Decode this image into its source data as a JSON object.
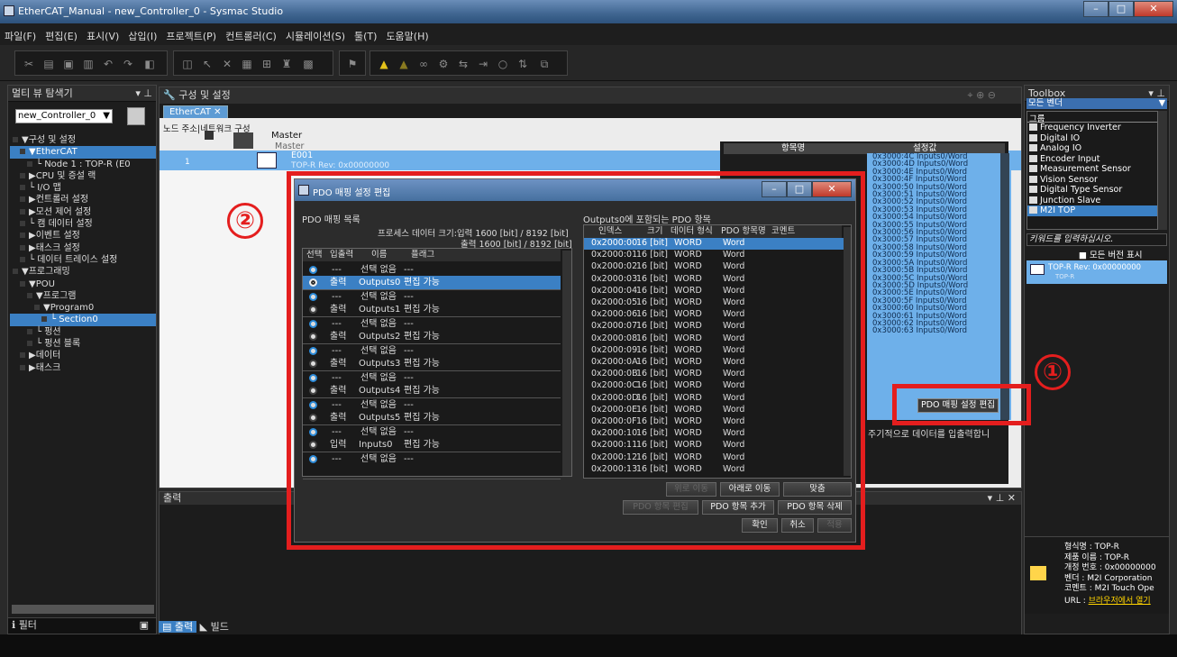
{
  "window": {
    "title": "EtherCAT_Manual - new_Controller_0 - Sysmac Studio"
  },
  "menu": [
    "파일(F)",
    "편집(E)",
    "표시(V)",
    "삽입(I)",
    "프로젝트(P)",
    "컨트롤러(C)",
    "시뮬레이션(S)",
    "툴(T)",
    "도움말(H)"
  ],
  "left": {
    "title": "멀티 뷰 탐색기",
    "controller": "new_Controller_0",
    "tree": [
      {
        "label": "▼구성 및 설정",
        "indent": 0,
        "sel": false
      },
      {
        "label": "▼EtherCAT",
        "indent": 1,
        "sel": true
      },
      {
        "label": "└ Node 1 : TOP-R (E0",
        "indent": 2,
        "sel": false
      },
      {
        "label": "▶CPU 및 증설 랙",
        "indent": 1,
        "sel": false
      },
      {
        "label": "└ I/O 맵",
        "indent": 1,
        "sel": false
      },
      {
        "label": "▶컨트롤러 설정",
        "indent": 1,
        "sel": false
      },
      {
        "label": "▶모션 제어 설정",
        "indent": 1,
        "sel": false
      },
      {
        "label": "└ 캠 데이터 설정",
        "indent": 1,
        "sel": false
      },
      {
        "label": "▶이벤트 설정",
        "indent": 1,
        "sel": false
      },
      {
        "label": "▶태스크 설정",
        "indent": 1,
        "sel": false
      },
      {
        "label": "└ 데이터 트레이스 설정",
        "indent": 1,
        "sel": false
      },
      {
        "label": "▼프로그래밍",
        "indent": 0,
        "sel": false
      },
      {
        "label": "▼POU",
        "indent": 1,
        "sel": false
      },
      {
        "label": "▼프로그램",
        "indent": 2,
        "sel": false
      },
      {
        "label": "▼Program0",
        "indent": 3,
        "sel": false
      },
      {
        "label": "└ Section0",
        "indent": 4,
        "sel": true
      },
      {
        "label": "└ 펑션",
        "indent": 2,
        "sel": false
      },
      {
        "label": "└ 펑션 블록",
        "indent": 2,
        "sel": false
      },
      {
        "label": "▶데이터",
        "indent": 1,
        "sel": false
      },
      {
        "label": "▶태스크",
        "indent": 1,
        "sel": false
      }
    ],
    "filter": "필터"
  },
  "center": {
    "title": "구성 및 설정",
    "tab": "EtherCAT",
    "col_node": "노드 주소",
    "col_net": "네트워크 구성",
    "master": "Master",
    "master2": "Master",
    "node_addr": "1",
    "node_name": "E001",
    "node_rev": "TOP-R Rev: 0x00000000",
    "settings_hdr1": "항목명",
    "settings_hdr2": "설정값",
    "settings_values": [
      "0x3000:4C Inputs0/Word",
      "0x3000:4D Inputs0/Word",
      "0x3000:4E Inputs0/Word",
      "0x3000:4F Inputs0/Word",
      "0x3000:50 Inputs0/Word",
      "0x3000:51 Inputs0/Word",
      "0x3000:52 Inputs0/Word",
      "0x3000:53 Inputs0/Word",
      "0x3000:54 Inputs0/Word",
      "0x3000:55 Inputs0/Word",
      "0x3000:56 Inputs0/Word",
      "0x3000:57 Inputs0/Word",
      "0x3000:58 Inputs0/Word",
      "0x3000:59 Inputs0/Word",
      "0x3000:5A Inputs0/Word",
      "0x3000:5B Inputs0/Word",
      "0x3000:5C Inputs0/Word",
      "0x3000:5D Inputs0/Word",
      "0x3000:5E Inputs0/Word",
      "0x3000:5F Inputs0/Word",
      "0x3000:60 Inputs0/Word",
      "0x3000:61 Inputs0/Word",
      "0x3000:62 Inputs0/Word",
      "0x3000:63 Inputs0/Word"
    ],
    "pdo_btn": "PDO 매핑 설정 편집",
    "desc": "주기적으로 데이터를 입출력합니"
  },
  "output": {
    "title": "출력",
    "tab_out": "출력",
    "tab_build": "빌드"
  },
  "toolbox": {
    "title": "Toolbox",
    "vendor": "모든 벤더",
    "group": "그룹",
    "items": [
      "Frequency Inverter",
      "Digital IO",
      "Analog IO",
      "Encoder Input",
      "Measurement Sensor",
      "Vision Sensor",
      "Digital Type Sensor",
      "Junction Slave",
      "M2I TOP"
    ],
    "keyword_placeholder": "키워드를 입력하십시오.",
    "allver": "모든 버전 표시",
    "device": "TOP-R Rev: 0x00000000",
    "device_sub": "TOP-R",
    "info": [
      "형식명 : TOP-R",
      "제품 이름 : TOP-R",
      "개정 번호 : 0x00000000",
      "벤더 : M2I Corporation",
      "코멘트 : M2I Touch Ope"
    ],
    "url_label": "URL : ",
    "url_link": "브라우저에서 열기"
  },
  "dialog": {
    "title": "PDO 매핑 설정 편집",
    "list_title": "PDO 매핑 목록",
    "size_in": "프로세스 데이터 크기:입력 1600 [bit] / 8192 [bit]",
    "size_out": "출력 1600 [bit] / 8192 [bit]",
    "cols": [
      "선택",
      "입출력",
      "이름",
      "플래그"
    ],
    "groups": [
      {
        "r1": [
          "---",
          "선택 없음",
          "---"
        ],
        "r2": [
          "출력",
          "Outputs0",
          "편집 가능"
        ],
        "sel": 2
      },
      {
        "r1": [
          "---",
          "선택 없음",
          "---"
        ],
        "r2": [
          "출력",
          "Outputs1",
          "편집 가능"
        ],
        "sel": 0
      },
      {
        "r1": [
          "---",
          "선택 없음",
          "---"
        ],
        "r2": [
          "출력",
          "Outputs2",
          "편집 가능"
        ],
        "sel": 0
      },
      {
        "r1": [
          "---",
          "선택 없음",
          "---"
        ],
        "r2": [
          "출력",
          "Outputs3",
          "편집 가능"
        ],
        "sel": 0
      },
      {
        "r1": [
          "---",
          "선택 없음",
          "---"
        ],
        "r2": [
          "출력",
          "Outputs4",
          "편집 가능"
        ],
        "sel": 0
      },
      {
        "r1": [
          "---",
          "선택 없음",
          "---"
        ],
        "r2": [
          "출력",
          "Outputs5",
          "편집 가능"
        ],
        "sel": 0
      },
      {
        "r1": [
          "---",
          "선택 없음",
          "---"
        ],
        "r2": [
          "입력",
          "Inputs0",
          "편집 가능"
        ],
        "sel": 0
      },
      {
        "r1": [
          "---",
          "선택 없음",
          "---"
        ],
        "r2": [],
        "sel": 0
      }
    ],
    "right_title": "Outputs0에 포함되는 PDO 항목",
    "pcols": [
      "인덱스",
      "크기",
      "데이터 형식",
      "PDO 항목명",
      "코멘트"
    ],
    "pdo_items": [
      [
        "0x2000:00",
        "16 [bit]",
        "WORD",
        "Word"
      ],
      [
        "0x2000:01",
        "16 [bit]",
        "WORD",
        "Word"
      ],
      [
        "0x2000:02",
        "16 [bit]",
        "WORD",
        "Word"
      ],
      [
        "0x2000:03",
        "16 [bit]",
        "WORD",
        "Word"
      ],
      [
        "0x2000:04",
        "16 [bit]",
        "WORD",
        "Word"
      ],
      [
        "0x2000:05",
        "16 [bit]",
        "WORD",
        "Word"
      ],
      [
        "0x2000:06",
        "16 [bit]",
        "WORD",
        "Word"
      ],
      [
        "0x2000:07",
        "16 [bit]",
        "WORD",
        "Word"
      ],
      [
        "0x2000:08",
        "16 [bit]",
        "WORD",
        "Word"
      ],
      [
        "0x2000:09",
        "16 [bit]",
        "WORD",
        "Word"
      ],
      [
        "0x2000:0A",
        "16 [bit]",
        "WORD",
        "Word"
      ],
      [
        "0x2000:0B",
        "16 [bit]",
        "WORD",
        "Word"
      ],
      [
        "0x2000:0C",
        "16 [bit]",
        "WORD",
        "Word"
      ],
      [
        "0x2000:0D",
        "16 [bit]",
        "WORD",
        "Word"
      ],
      [
        "0x2000:0E",
        "16 [bit]",
        "WORD",
        "Word"
      ],
      [
        "0x2000:0F",
        "16 [bit]",
        "WORD",
        "Word"
      ],
      [
        "0x2000:10",
        "16 [bit]",
        "WORD",
        "Word"
      ],
      [
        "0x2000:11",
        "16 [bit]",
        "WORD",
        "Word"
      ],
      [
        "0x2000:12",
        "16 [bit]",
        "WORD",
        "Word"
      ],
      [
        "0x2000:13",
        "16 [bit]",
        "WORD",
        "Word"
      ]
    ],
    "btn_up": "위로 이동",
    "btn_down": "아래로 이동",
    "btn_fit": "맞춤",
    "btn_edit": "PDO 항목 편집",
    "btn_add": "PDO 항목 추가",
    "btn_del": "PDO 항목 삭제",
    "btn_ok": "확인",
    "btn_cancel": "취소",
    "btn_apply": "적용"
  },
  "annotations": {
    "one": "①",
    "two": "②"
  }
}
